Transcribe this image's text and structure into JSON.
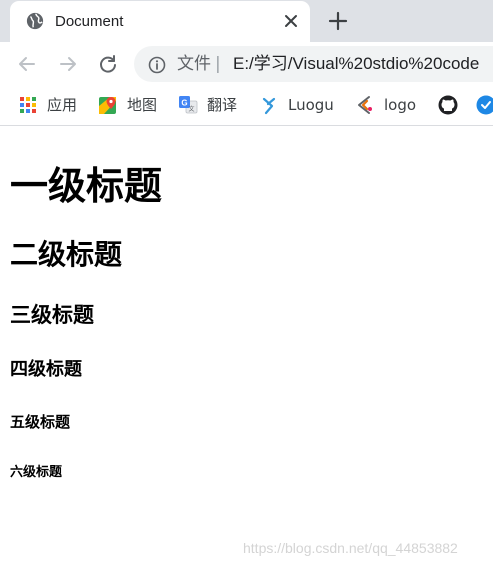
{
  "tab": {
    "title": "Document",
    "favicon": "globe-icon",
    "close_icon": "close-icon"
  },
  "new_tab_icon": "plus-icon",
  "toolbar": {
    "back_icon": "arrow-left-icon",
    "forward_icon": "arrow-right-icon",
    "reload_icon": "reload-icon",
    "info_icon": "info-icon",
    "scheme_label": "文件",
    "separator": "|",
    "url": "E:/学习/Visual%20stdio%20code"
  },
  "bookmarks": [
    {
      "label": "应用",
      "icon": "apps-grid-icon"
    },
    {
      "label": "地图",
      "icon": "maps-icon"
    },
    {
      "label": "翻译",
      "icon": "translate-icon"
    },
    {
      "label": "Luogu",
      "icon": "luogu-icon"
    },
    {
      "label": "logo",
      "icon": "logo-icon"
    },
    {
      "label": "",
      "icon": "github-icon"
    },
    {
      "label": "",
      "icon": "extension-icon"
    }
  ],
  "content": {
    "h1": "一级标题",
    "h2": "二级标题",
    "h3": "三级标题",
    "h4": "四级标题",
    "h5": "五级标题",
    "h6": "六级标题"
  },
  "watermark": "https://blog.csdn.net/qq_44853882",
  "colors": {
    "tabstrip_bg": "#dee1e6",
    "omnibox_bg": "#f1f3f4",
    "text": "#202124",
    "muted": "#5f6368"
  }
}
